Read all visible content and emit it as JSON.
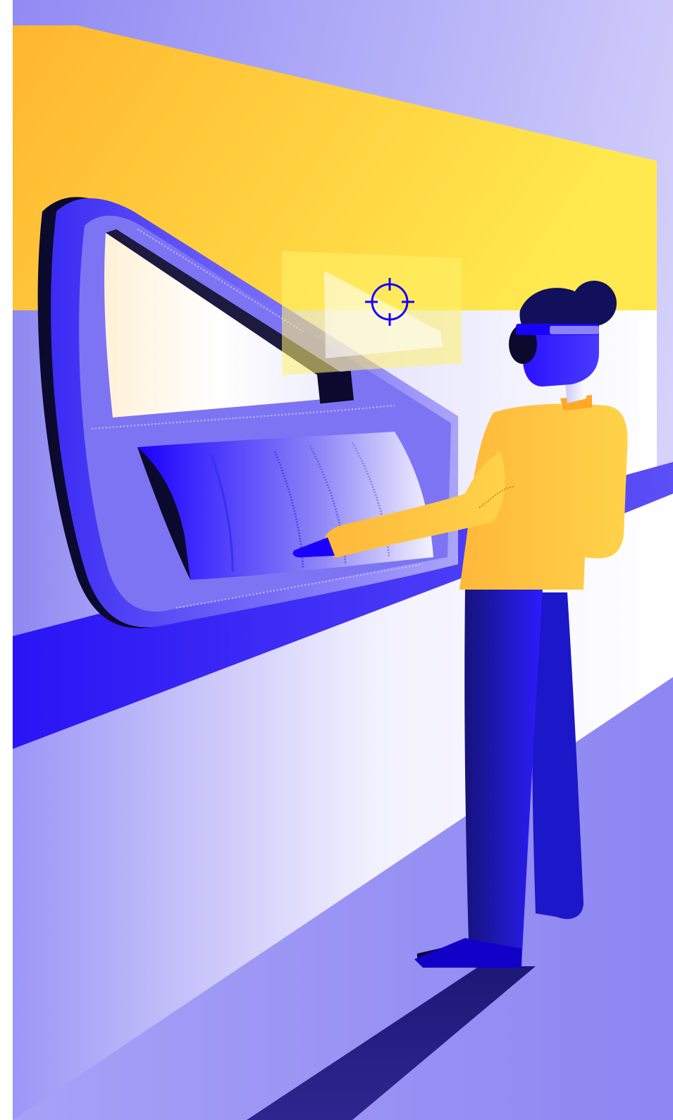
{
  "illustration": {
    "subject": "person-wearing-vr-headset-at-curved-display",
    "palette": {
      "yellow": "#ffc83c",
      "yellow_light": "#ffe566",
      "blue": "#1a00ff",
      "blue_dark": "#12105a",
      "lavender": "#9b95f5",
      "lavender_light": "#dcdafb",
      "navy": "#0b0a2e",
      "white": "#ffffff"
    },
    "icons": [
      "crosshair-icon"
    ]
  }
}
